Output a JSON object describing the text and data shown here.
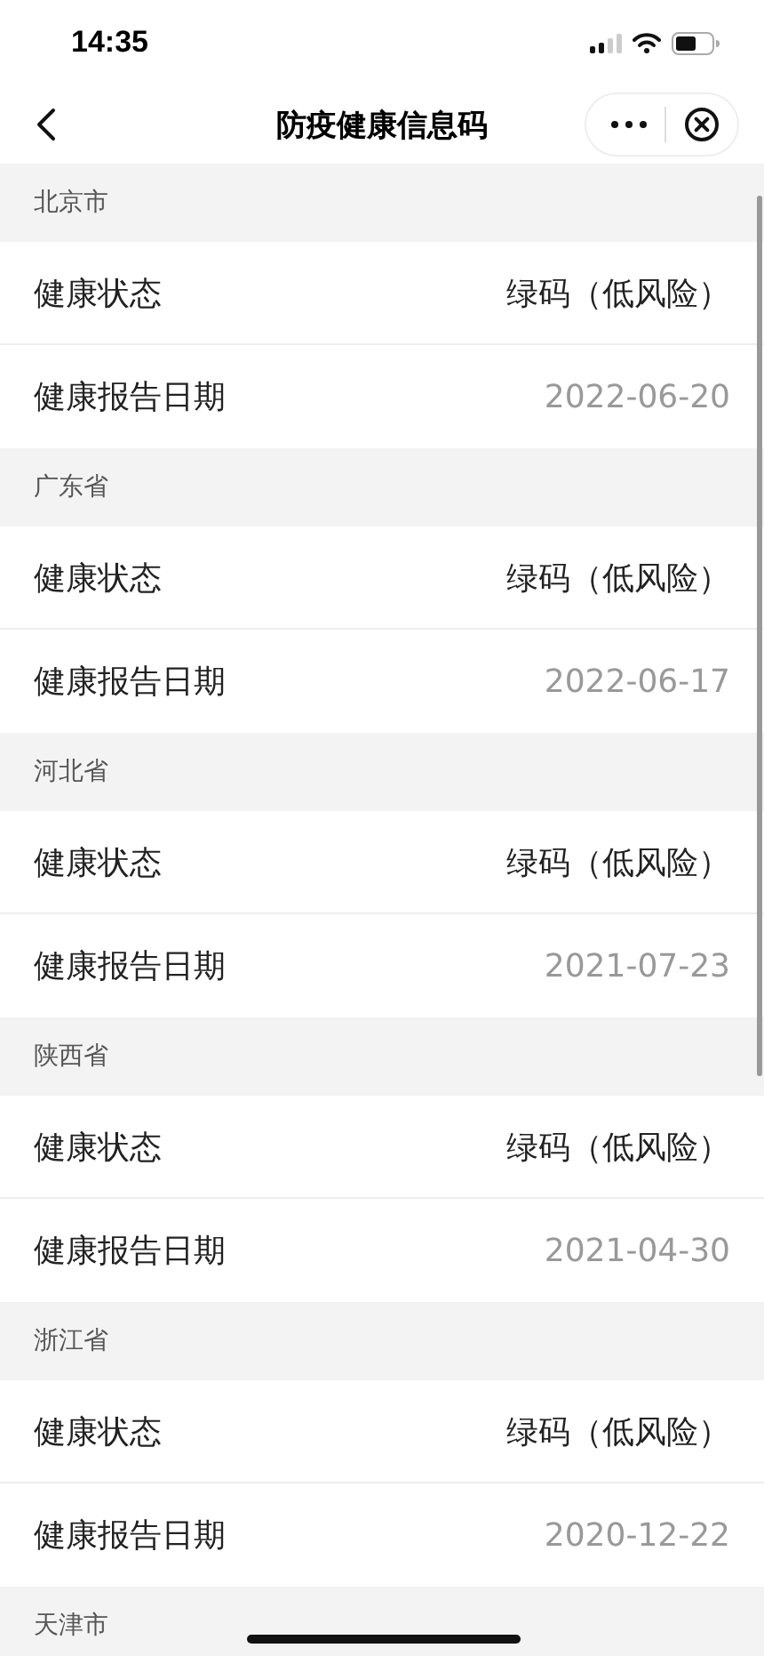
{
  "status_bar": {
    "time": "14:35"
  },
  "nav": {
    "title": "防疫健康信息码"
  },
  "sections": [
    {
      "region": "北京市",
      "rows": [
        {
          "kind": "status",
          "label": "健康状态",
          "value": "绿码（低风险）"
        },
        {
          "kind": "date",
          "label": "健康报告日期",
          "value": "2022-06-20"
        }
      ]
    },
    {
      "region": "广东省",
      "rows": [
        {
          "kind": "status",
          "label": "健康状态",
          "value": "绿码（低风险）"
        },
        {
          "kind": "date",
          "label": "健康报告日期",
          "value": "2022-06-17"
        }
      ]
    },
    {
      "region": "河北省",
      "rows": [
        {
          "kind": "status",
          "label": "健康状态",
          "value": "绿码（低风险）"
        },
        {
          "kind": "date",
          "label": "健康报告日期",
          "value": "2021-07-23"
        }
      ]
    },
    {
      "region": "陕西省",
      "rows": [
        {
          "kind": "status",
          "label": "健康状态",
          "value": "绿码（低风险）"
        },
        {
          "kind": "date",
          "label": "健康报告日期",
          "value": "2021-04-30"
        }
      ]
    },
    {
      "region": "浙江省",
      "rows": [
        {
          "kind": "status",
          "label": "健康状态",
          "value": "绿码（低风险）"
        },
        {
          "kind": "date",
          "label": "健康报告日期",
          "value": "2020-12-22"
        }
      ]
    },
    {
      "region": "天津市"
    }
  ]
}
